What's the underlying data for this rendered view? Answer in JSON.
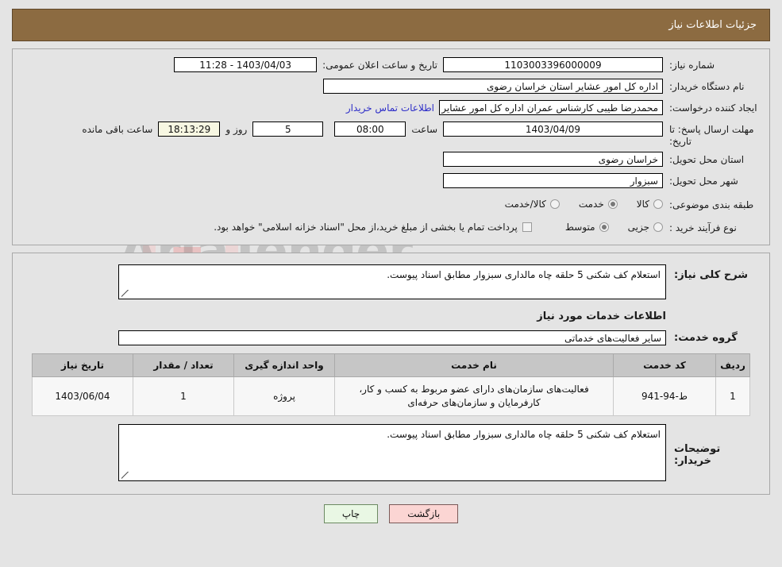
{
  "header": {
    "title": "جزئیات اطلاعات نیاز"
  },
  "summary": {
    "need_number_label": "شماره نیاز:",
    "need_number_value": "1103003396000009",
    "public_announce_label": "تاریخ و ساعت اعلان عمومی:",
    "public_announce_value": "1403/04/03 - 11:28",
    "buyer_org_label": "نام دستگاه خریدار:",
    "buyer_org_value": "اداره کل امور عشایر استان خراسان رضوی",
    "creator_label": "ایجاد کننده درخواست:",
    "creator_value": "محمدرضا طیبی کارشناس عمران اداره کل امور عشایر استان خراسان رضوی",
    "contact_link": "اطلاعات تماس خریدار",
    "deadline_label": "مهلت ارسال پاسخ: تا تاریخ:",
    "deadline_date": "1403/04/09",
    "hour_label": "ساعت",
    "deadline_time": "08:00",
    "days_remaining": "5",
    "days_label": "روز و",
    "hours_remaining": "18:13:29",
    "remaining_suffix": "ساعت باقی مانده",
    "province_label": "استان محل تحویل:",
    "province_value": "خراسان رضوی",
    "city_label": "شهر محل تحویل:",
    "city_value": "سبزوار",
    "classification_label": "طبقه بندی موضوعی:",
    "classification_options": [
      {
        "label": "کالا",
        "selected": false
      },
      {
        "label": "خدمت",
        "selected": true
      },
      {
        "label": "کالا/خدمت",
        "selected": false
      }
    ],
    "purchase_type_label": "نوع فرآیند خرید :",
    "purchase_type_options": [
      {
        "label": "جزیی",
        "selected": false
      },
      {
        "label": "متوسط",
        "selected": true
      }
    ],
    "treasury_checkbox_text": "پرداخت تمام یا بخشی از مبلغ خرید،از محل \"اسناد خزانه اسلامی\" خواهد بود.",
    "treasury_checked": false
  },
  "details": {
    "need_desc_label": "شرح کلی نیاز:",
    "need_desc_value": "استعلام کف شکنی 5 حلقه چاه مالداری سبزوار مطابق اسناد پیوست.",
    "services_section_title": "اطلاعات خدمات مورد نیاز",
    "service_group_label": "گروه خدمت:",
    "service_group_value": "سایر فعالیت‌های خدماتی",
    "buyer_remarks_label": "توضیحات خریدار:",
    "buyer_remarks_value": "استعلام کف شکنی 5 حلقه چاه مالداری سبزوار مطابق اسناد پیوست."
  },
  "items_table": {
    "columns": [
      "ردیف",
      "کد خدمت",
      "نام خدمت",
      "واحد اندازه گیری",
      "تعداد / مقدار",
      "تاریخ نیاز"
    ],
    "rows": [
      {
        "radif": "1",
        "code": "ط-94-941",
        "name": "فعالیت‌های سازمان‌های دارای عضو مربوط به کسب و کار، کارفرمایان و سازمان‌های حرفه‌ای",
        "unit": "پروژه",
        "qty": "1",
        "date": "1403/06/04"
      }
    ]
  },
  "footer": {
    "back_label": "بازگشت",
    "print_label": "چاپ"
  }
}
